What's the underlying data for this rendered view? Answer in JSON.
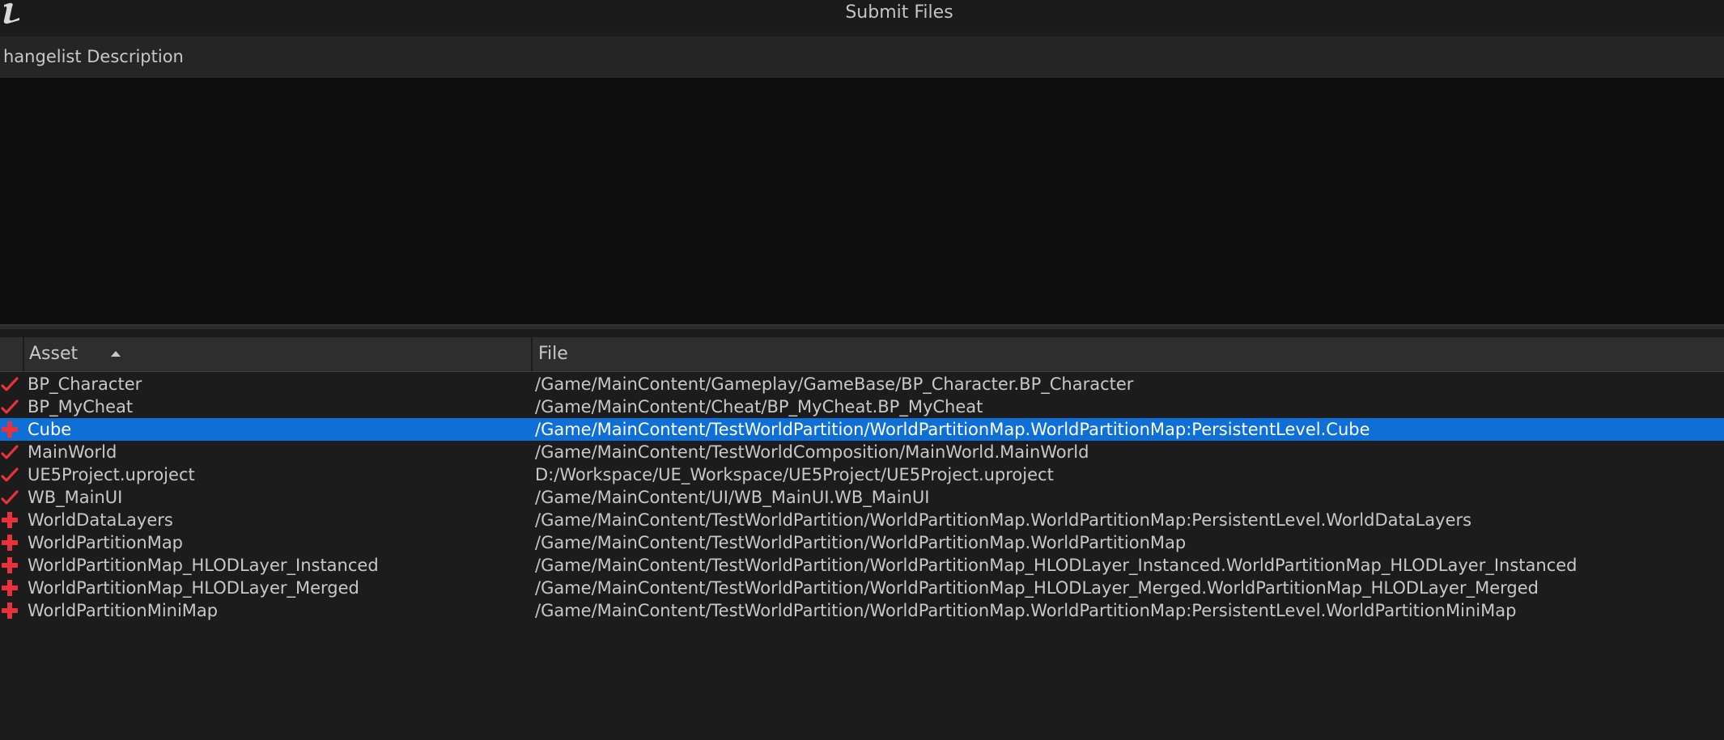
{
  "window": {
    "title": "Submit Files",
    "logo_icon": "unreal-engine-logo-icon"
  },
  "description": {
    "label": "hangelist Description",
    "value": ""
  },
  "table": {
    "columns": {
      "asset": "Asset",
      "file": "File"
    },
    "sort_column": "Asset",
    "sort_direction": "ascending",
    "rows": [
      {
        "asset": "BP_Character",
        "file": "/Game/MainContent/Gameplay/GameBase/BP_Character.BP_Character",
        "status": "checked-out",
        "status_icon": "checkmark-icon",
        "selected": false
      },
      {
        "asset": "BP_MyCheat",
        "file": "/Game/MainContent/Cheat/BP_MyCheat.BP_MyCheat",
        "status": "checked-out",
        "status_icon": "checkmark-icon",
        "selected": false
      },
      {
        "asset": "Cube",
        "file": "/Game/MainContent/TestWorldPartition/WorldPartitionMap.WorldPartitionMap:PersistentLevel.Cube",
        "status": "added",
        "status_icon": "plus-icon",
        "selected": true
      },
      {
        "asset": "MainWorld",
        "file": "/Game/MainContent/TestWorldComposition/MainWorld.MainWorld",
        "status": "checked-out",
        "status_icon": "checkmark-icon",
        "selected": false
      },
      {
        "asset": "UE5Project.uproject",
        "file": "D:/Workspace/UE_Workspace/UE5Project/UE5Project.uproject",
        "status": "checked-out",
        "status_icon": "checkmark-icon",
        "selected": false
      },
      {
        "asset": "WB_MainUI",
        "file": "/Game/MainContent/UI/WB_MainUI.WB_MainUI",
        "status": "checked-out",
        "status_icon": "checkmark-icon",
        "selected": false
      },
      {
        "asset": "WorldDataLayers",
        "file": "/Game/MainContent/TestWorldPartition/WorldPartitionMap.WorldPartitionMap:PersistentLevel.WorldDataLayers",
        "status": "added",
        "status_icon": "plus-icon",
        "selected": false
      },
      {
        "asset": "WorldPartitionMap",
        "file": "/Game/MainContent/TestWorldPartition/WorldPartitionMap.WorldPartitionMap",
        "status": "added",
        "status_icon": "plus-icon",
        "selected": false
      },
      {
        "asset": "WorldPartitionMap_HLODLayer_Instanced",
        "file": "/Game/MainContent/TestWorldPartition/WorldPartitionMap_HLODLayer_Instanced.WorldPartitionMap_HLODLayer_Instanced",
        "status": "added",
        "status_icon": "plus-icon",
        "selected": false
      },
      {
        "asset": "WorldPartitionMap_HLODLayer_Merged",
        "file": "/Game/MainContent/TestWorldPartition/WorldPartitionMap_HLODLayer_Merged.WorldPartitionMap_HLODLayer_Merged",
        "status": "added",
        "status_icon": "plus-icon",
        "selected": false
      },
      {
        "asset": "WorldPartitionMiniMap",
        "file": "/Game/MainContent/TestWorldPartition/WorldPartitionMap.WorldPartitionMap:PersistentLevel.WorldPartitionMiniMap",
        "status": "added",
        "status_icon": "plus-icon",
        "selected": false
      }
    ]
  },
  "colors": {
    "background": "#1c1c1c",
    "selection": "#0e6fd6",
    "status_red": "#e8323c",
    "text": "#c8c8c8"
  }
}
